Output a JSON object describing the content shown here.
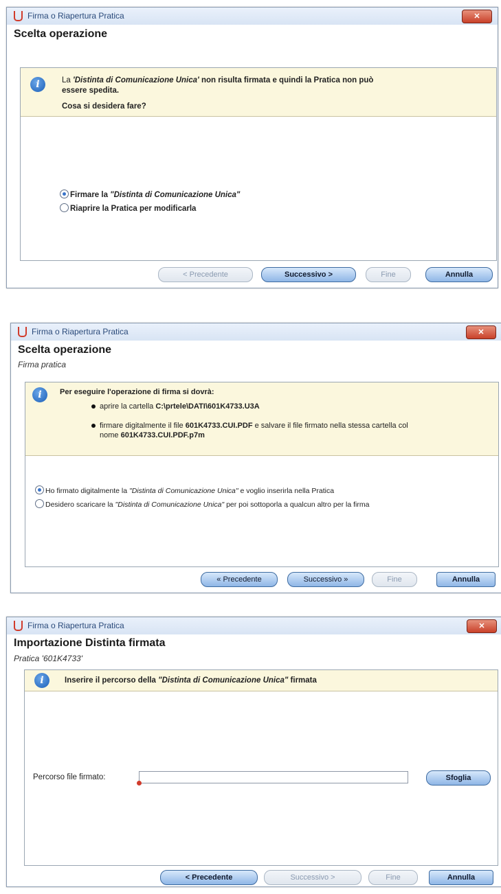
{
  "window_title": "Firma o Riapertura Pratica",
  "close_label": "✕",
  "dialogs": [
    {
      "heading": "Scelta operazione",
      "message_line1_pre": "La ",
      "message_line1_em": "'Distinta di Comunicazione Unica'",
      "message_line1_post": " non risulta firmata e quindi la Pratica non può",
      "message_line2": "essere spedita.",
      "question": "Cosa si desidera fare?",
      "options": [
        {
          "pre": "Firmare la ",
          "em": "\"Distinta di Comunicazione Unica\"",
          "post": "",
          "checked": true
        },
        {
          "pre": "Riaprire la Pratica per modificarla",
          "em": "",
          "post": "",
          "checked": false
        }
      ],
      "buttons": {
        "previous": "< Precedente",
        "next": "Successivo >",
        "finish": "Fine",
        "cancel": "Annulla"
      }
    },
    {
      "heading": "Scelta operazione",
      "subheading": "Firma pratica",
      "intro": "Per eseguire l'operazione di firma si dovrà:",
      "step1_pre": "aprire la cartella ",
      "step1_path": "C:\\prtele\\DATI\\601K4733.U3A",
      "step2_pre": "firmare digitalmente il file ",
      "step2_file": "601K4733.CUI.PDF",
      "step2_mid": " e salvare il file firmato nella stessa cartella col",
      "step2_line2_pre": "nome ",
      "step2_line2_file": "601K4733.CUI.PDF.p7m",
      "options": [
        {
          "pre": "Ho firmato digitalmente la ",
          "em": "\"Distinta di Comunicazione Unica\"",
          "post": " e voglio inserirla nella Pratica",
          "checked": true
        },
        {
          "pre": "Desidero scaricare la ",
          "em": "\"Distinta di Comunicazione Unica\"",
          "post": " per poi sottoporla a qualcun altro per la firma",
          "checked": false
        }
      ],
      "buttons": {
        "previous": "« Precedente",
        "next": "Successivo »",
        "finish": "Fine",
        "cancel": "Annulla"
      }
    },
    {
      "heading": "Importazione Distinta firmata",
      "subheading": "Pratica '601K4733'",
      "message_pre": "Inserire il percorso della ",
      "message_em": "\"Distinta di Comunicazione Unica\"",
      "message_post": " firmata",
      "field_label": "Percorso file firmato:",
      "field_value": "",
      "browse": "Sfoglia",
      "buttons": {
        "previous": "< Precedente",
        "next": "Successivo >",
        "finish": "Fine",
        "cancel": "Annulla"
      }
    }
  ]
}
